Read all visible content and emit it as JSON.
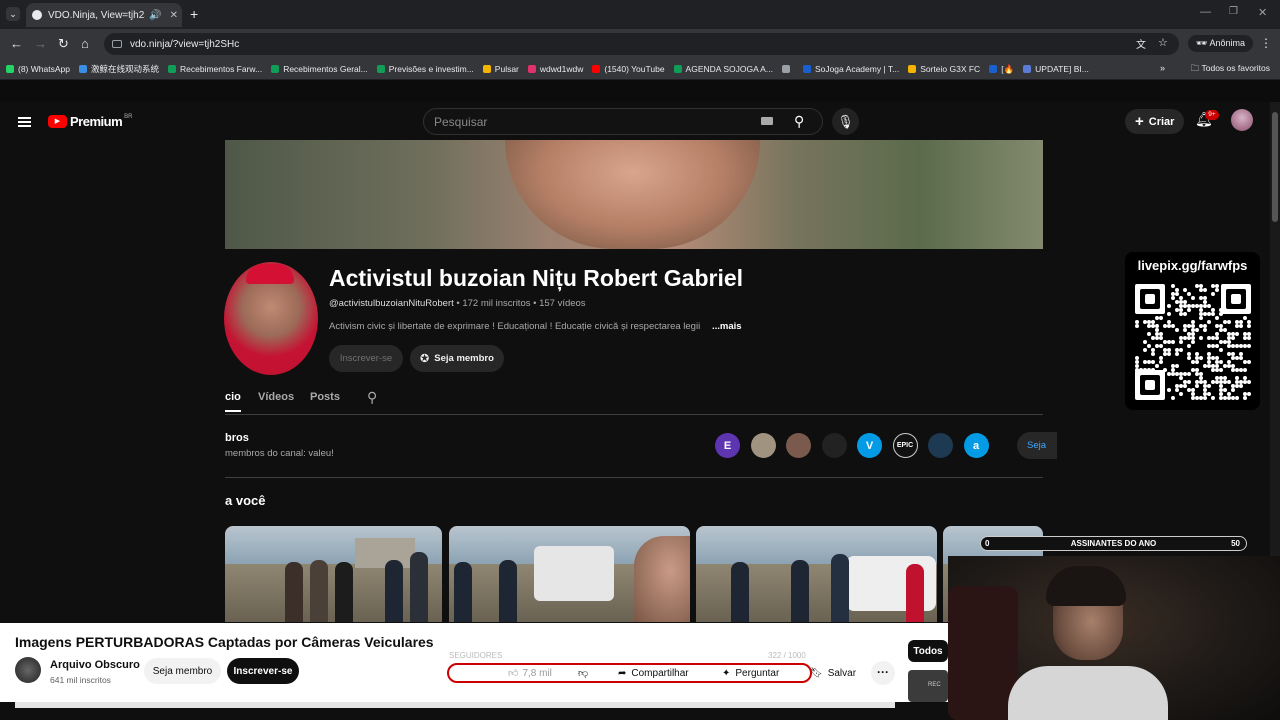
{
  "browser": {
    "tab_title": "VDO.Ninja, View=tjh2SHc",
    "url": "vdo.ninja/?view=tjh2SHc",
    "profile_label": "Anônima",
    "bookmarks": [
      {
        "label": "(8) WhatsApp",
        "color": "#25d366"
      },
      {
        "label": "激鲸在线观动系统",
        "color": "#3a8ee6"
      },
      {
        "label": "Recebimentos Farw...",
        "color": "#0f9d58"
      },
      {
        "label": "Recebimentos Geral...",
        "color": "#0f9d58"
      },
      {
        "label": "Previsões e investim...",
        "color": "#0f9d58"
      },
      {
        "label": "Pulsar",
        "color": "#f4b400"
      },
      {
        "label": "wdwd1wdw",
        "color": "#e1306c"
      },
      {
        "label": "(1540) YouTube",
        "color": "#ff0000"
      },
      {
        "label": "AGENDA SOJOGA A...",
        "color": "#0f9d58"
      },
      {
        "label": "",
        "color": "#9aa0a6"
      },
      {
        "label": "SoJoga Academy | T...",
        "color": "#1a5fd0"
      },
      {
        "label": "Sorteio G3X FC",
        "color": "#f4b400"
      },
      {
        "label": "[🔥",
        "color": "#1a5fd0"
      },
      {
        "label": "UPDATE] BI...",
        "color": "#5b7bd5"
      }
    ],
    "bookmarks_folder": "Todos os favoritos"
  },
  "youtube": {
    "logo_text": "Premium",
    "logo_region": "BR",
    "search_placeholder": "Pesquisar",
    "create_label": "Criar",
    "notif_count": "9+"
  },
  "channel": {
    "name": "Activistul buzoian Nițu Robert Gabriel",
    "handle": "@activistulbuzoianNituRobert",
    "stats": " • 172 mil inscritos • 157 vídeos",
    "description": "Activism civic și libertate de exprimare ! Educațional ! Educație civică și respectarea legii",
    "more": "...mais",
    "subscribe_label": "Inscrever-se",
    "join_label": "Seja membro",
    "tabs": [
      "cio",
      "Vídeos",
      "Posts"
    ],
    "members_title": "bros",
    "members_sub": "membros do canal: valeu!",
    "member_avatars": [
      {
        "letter": "E",
        "color": "#5e35b1"
      },
      {
        "letter": "",
        "color": "#a0937f"
      },
      {
        "letter": "",
        "color": "#7a5a4c"
      },
      {
        "letter": "",
        "color": "#222222"
      },
      {
        "letter": "V",
        "color": "#039be5"
      },
      {
        "letter": "EPIC",
        "color": "#111111"
      },
      {
        "letter": "",
        "color": "#1d3a52"
      },
      {
        "letter": "a",
        "color": "#039be5"
      }
    ],
    "members_join": "Seja",
    "section_title": "a você"
  },
  "overlay": {
    "qr_text": "livepix.gg/farwfps",
    "subs_label": "ASSINANTES DO ANO",
    "subs_current": "0",
    "subs_goal": "50"
  },
  "video_bar": {
    "title": "Imagens PERTURBADORAS Captadas por Câmeras Veiculares",
    "channel": "Arquivo Obscuro",
    "subs": "641 mil inscritos",
    "join_label": "Seja membro",
    "subscribe_label": "Inscrever-se",
    "followers_label": "SEGUIDORES",
    "goal_label": "322 / 1000",
    "like_label": "7,8 mil",
    "share_label": "Compartilhar",
    "ask_label": "Perguntar",
    "save_label": "Salvar",
    "more_label": "···",
    "todos_label": "Todos",
    "rec_label": "REC"
  }
}
